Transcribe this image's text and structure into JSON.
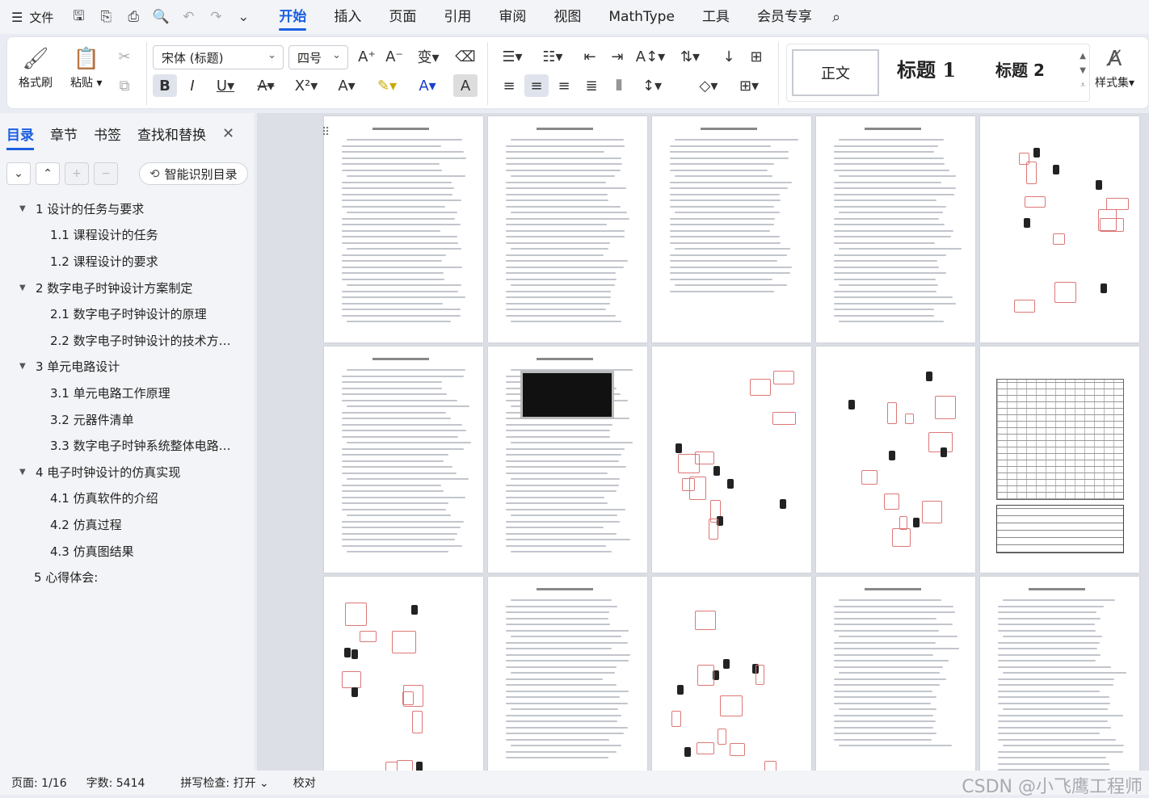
{
  "menubar": {
    "menu_icon": "hamburger-icon",
    "file_label": "文件",
    "tabs": [
      {
        "label": "开始",
        "active": true
      },
      {
        "label": "插入"
      },
      {
        "label": "页面"
      },
      {
        "label": "引用"
      },
      {
        "label": "审阅"
      },
      {
        "label": "视图"
      },
      {
        "label": "MathType"
      },
      {
        "label": "工具"
      },
      {
        "label": "会员专享"
      }
    ]
  },
  "ribbon": {
    "format_painter": "格式刷",
    "paste": "粘贴",
    "font_name": "宋体 (标题)",
    "font_size": "四号",
    "styles": {
      "normal": "正文",
      "h1": "标题 1",
      "h2": "标题 2",
      "more": "样式集"
    }
  },
  "nav": {
    "tabs": [
      "目录",
      "章节",
      "书签",
      "查找和替换"
    ],
    "smart_toc": "智能识别目录",
    "toc": [
      {
        "label": "1 设计的任务与要求",
        "level": 1,
        "arrow": true
      },
      {
        "label": "1.1 课程设计的任务",
        "level": 2
      },
      {
        "label": "1.2 课程设计的要求",
        "level": 2
      },
      {
        "label": "2 数字电子时钟设计方案制定",
        "level": 1,
        "arrow": true
      },
      {
        "label": "2.1 数字电子时钟设计的原理",
        "level": 2
      },
      {
        "label": "2.2 数字电子时钟设计的技术方…",
        "level": 2
      },
      {
        "label": "3 单元电路设计",
        "level": 1,
        "arrow": true
      },
      {
        "label": "3.1 单元电路工作原理",
        "level": 2
      },
      {
        "label": "3.2 元器件清单",
        "level": 2
      },
      {
        "label": "3.3 数字电子时钟系统整体电路…",
        "level": 2
      },
      {
        "label": "4 电子时钟设计的仿真实现",
        "level": 1,
        "arrow": true
      },
      {
        "label": "4.1 仿真软件的介绍",
        "level": 2
      },
      {
        "label": "4.2 仿真过程",
        "level": 2
      },
      {
        "label": "4.3 仿真图结果",
        "level": 2
      },
      {
        "label": "5 心得体会:",
        "level": 1,
        "arrow": false
      }
    ]
  },
  "status": {
    "page": "页面: 1/16",
    "words": "字数: 5414",
    "spell": "拼写检查: 打开",
    "proof": "校对"
  },
  "watermark": "CSDN @小飞鹰工程师"
}
